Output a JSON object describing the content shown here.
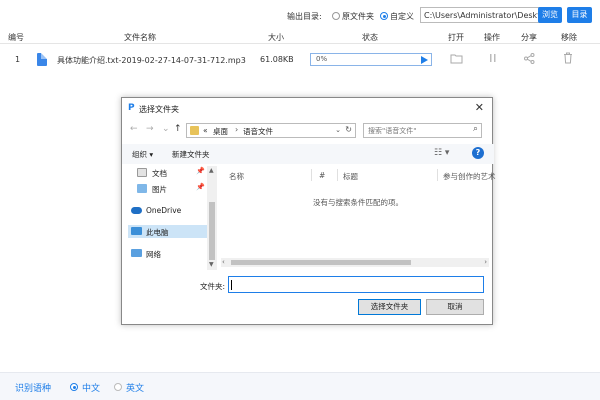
{
  "output": {
    "label": "输出目录:",
    "option_original": "原文件夹",
    "option_custom": "自定义",
    "selected": "自定义",
    "path": "C:\\Users\\Administrator\\Desktop",
    "browse_label": "浏览",
    "dir_label": "目录"
  },
  "table": {
    "headers": {
      "index": "编号",
      "name": "文件名称",
      "size": "大小",
      "status": "状态",
      "open": "打开",
      "action": "操作",
      "share": "分享",
      "remove": "移除"
    },
    "rows": [
      {
        "index": "1",
        "name": "具体功能介绍.txt-2019-02-27-14-07-31-712.mp3",
        "size": "61.08KB",
        "progress_text": "0%",
        "progress": 0
      }
    ]
  },
  "dialog": {
    "logo": "P",
    "title": "选择文件夹",
    "close": "✕",
    "breadcrumb_prefix": "«",
    "breadcrumb": [
      "桌面",
      "语音文件"
    ],
    "search_placeholder": "搜索\"语音文件\"",
    "organize_label": "组织 ▾",
    "new_folder_label": "新建文件夹",
    "help_label": "?",
    "nav_items": [
      {
        "label": "文档",
        "icon": "document-icon",
        "pinned": true
      },
      {
        "label": "图片",
        "icon": "picture-icon",
        "pinned": true
      },
      {
        "label": "OneDrive",
        "icon": "cloud-icon",
        "pinned": false
      },
      {
        "label": "此电脑",
        "icon": "computer-icon",
        "pinned": false,
        "selected": true
      },
      {
        "label": "网络",
        "icon": "network-icon",
        "pinned": false
      }
    ],
    "columns": {
      "name": "名称",
      "number": "#",
      "title": "标题",
      "artist": "参与创作的艺术"
    },
    "empty_message": "没有与搜索条件匹配的项。",
    "filename_label": "文件夹:",
    "filename_value": "",
    "select_label": "选择文件夹",
    "cancel_label": "取消"
  },
  "bottom": {
    "language_label": "识别语种",
    "option_zh": "中文",
    "option_en": "英文",
    "selected": "中文"
  },
  "colors": {
    "accent": "#1e7ee8",
    "selection": "#cce4f7"
  }
}
